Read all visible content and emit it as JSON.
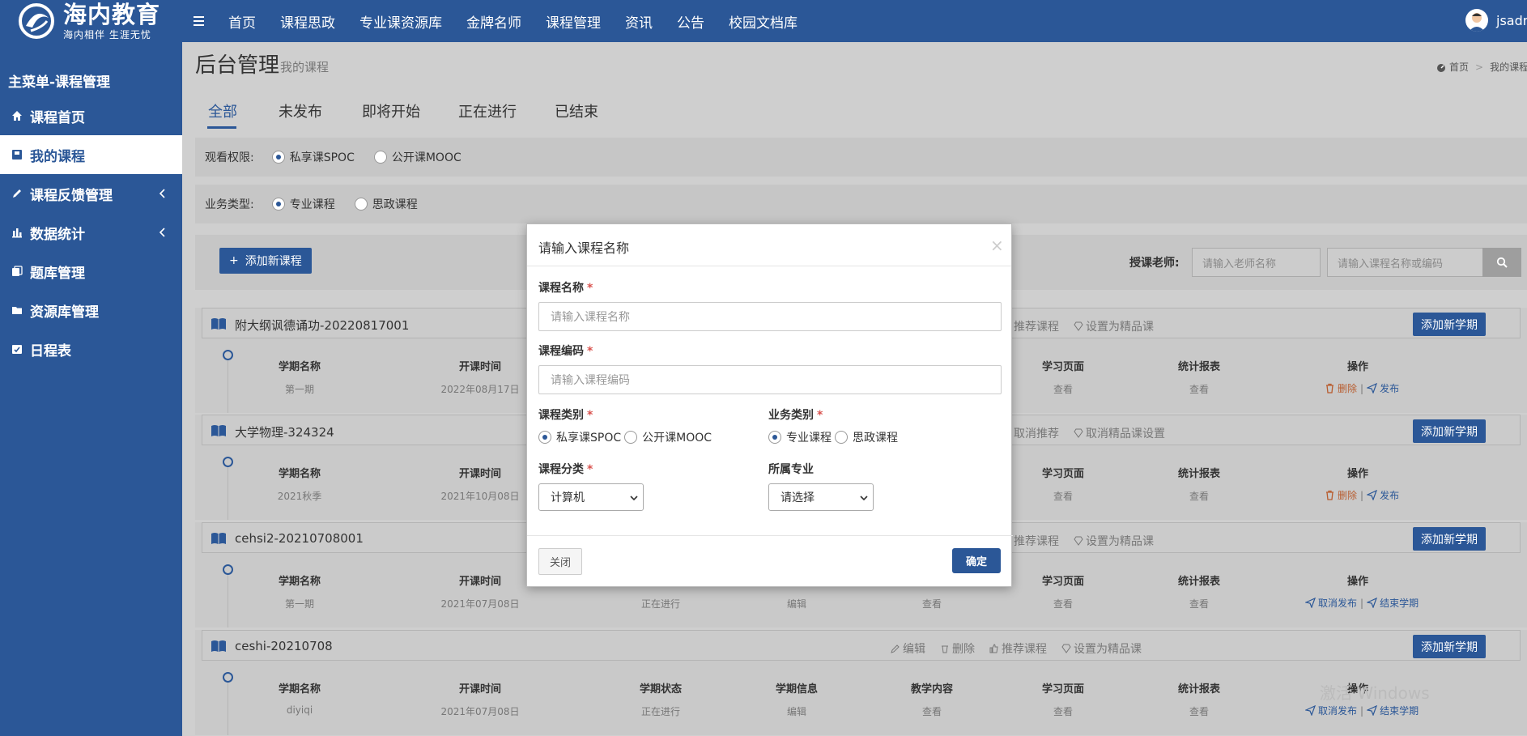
{
  "brand": {
    "name": "海内教育",
    "slogan": "海内相伴 生涯无忧"
  },
  "topnav": [
    "首页",
    "课程思政",
    "专业课资源库",
    "金牌名师",
    "课程管理",
    "资讯",
    "公告",
    "校园文档库"
  ],
  "user": {
    "name": "jsadm"
  },
  "sidebar": {
    "title": "主菜单-课程管理",
    "items": [
      {
        "label": "课程首页",
        "icon": "home-icon"
      },
      {
        "label": "我的课程",
        "icon": "book-icon"
      },
      {
        "label": "课程反馈管理",
        "icon": "pencil-icon"
      },
      {
        "label": "数据统计",
        "icon": "bar-chart-icon"
      },
      {
        "label": "题库管理",
        "icon": "copy-icon"
      },
      {
        "label": "资源库管理",
        "icon": "folder-icon"
      },
      {
        "label": "日程表",
        "icon": "calendar-icon"
      }
    ]
  },
  "page": {
    "title": "后台管理",
    "subtitle": "我的课程",
    "breadcrumb": [
      "首页",
      "我的课程"
    ]
  },
  "tabs": [
    "全部",
    "未发布",
    "即将开始",
    "正在进行",
    "已结束"
  ],
  "filters": {
    "access": {
      "label": "观看权限:",
      "options": [
        "私享课SPOC",
        "公开课MOOC"
      ],
      "selected": 0
    },
    "business": {
      "label": "业务类型:",
      "options": [
        "专业课程",
        "思政课程"
      ],
      "selected": 0
    }
  },
  "toolbar": {
    "add_course": "添加新课程",
    "teacher_label": "授课老师:",
    "teacher_placeholder": "请输入老师名称",
    "course_placeholder": "请输入课程名称或编码"
  },
  "term_headers": [
    "学期名称",
    "开课时间",
    "学期状态",
    "学期信息",
    "教学内容",
    "学习页面",
    "统计报表",
    "操作"
  ],
  "courses": [
    {
      "name": "附大纲讽德诵功-20220817001",
      "actions": [
        "推荐课程",
        "设置为精品课"
      ],
      "add_term": "添加新学期",
      "row": [
        "第一期",
        "2022年08月17日",
        "",
        "",
        "",
        "查看",
        "查看"
      ],
      "ops": [
        "删除",
        "发布"
      ]
    },
    {
      "name": "大学物理-324324",
      "actions": [
        "取消推荐",
        "取消精品课设置"
      ],
      "add_term": "添加新学期",
      "row": [
        "2021秋季",
        "2021年10月08日",
        "",
        "",
        "",
        "查看",
        "查看"
      ],
      "ops": [
        "删除",
        "发布"
      ]
    },
    {
      "name": "cehsi2-20210708001",
      "actions": [
        "推荐课程",
        "设置为精品课"
      ],
      "add_term": "添加新学期",
      "row": [
        "第一期",
        "2021年07月08日",
        "正在进行",
        "编辑",
        "查看",
        "查看",
        "查看"
      ],
      "ops": [
        "取消发布",
        "结束学期"
      ]
    },
    {
      "name": "ceshi-20210708",
      "actions": [
        "编辑",
        "删除",
        "推荐课程",
        "设置为精品课"
      ],
      "add_term": "添加新学期",
      "row": [
        "diyiqi",
        "2021年07月08日",
        "正在进行",
        "编辑",
        "查看",
        "查看",
        "查看"
      ],
      "ops": [
        "取消发布",
        "结束学期"
      ]
    }
  ],
  "modal": {
    "title": "请输入课程名称",
    "close_symbol": "×",
    "name_label": "课程名称",
    "name_placeholder": "请输入课程名称",
    "code_label": "课程编码",
    "code_placeholder": "请输入课程编码",
    "type_label": "课程类别",
    "type_options": [
      "私享课SPOC",
      "公开课MOOC"
    ],
    "business_label": "业务类别",
    "business_options": [
      "专业课程",
      "思政课程"
    ],
    "category_label": "课程分类",
    "category_value": "计算机",
    "major_label": "所属专业",
    "major_value": "请选择",
    "required_mark": "*",
    "close_button": "关闭",
    "ok_button": "确定"
  },
  "watermark": "激活 Windows",
  "colors": {
    "brand": "#2b5797",
    "danger": "#d9534f",
    "delete": "#b85c2e"
  }
}
